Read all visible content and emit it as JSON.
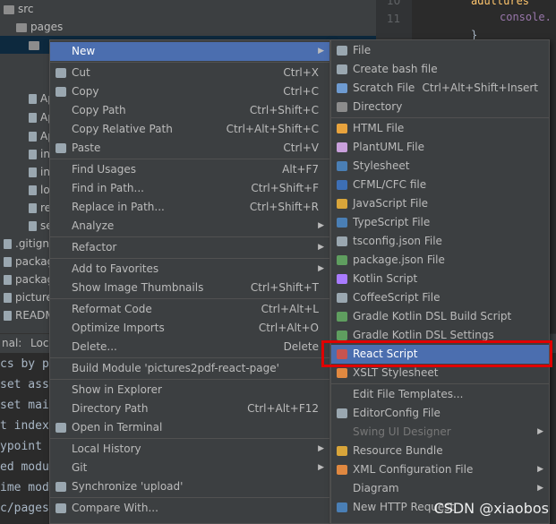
{
  "tree": {
    "rows": [
      {
        "label": "src",
        "kind": "folder"
      },
      {
        "label": "pages",
        "kind": "folder"
      },
      {
        "label": "",
        "kind": "folder"
      },
      {
        "label": "App",
        "kind": "file"
      },
      {
        "label": "App",
        "kind": "file"
      },
      {
        "label": "App",
        "kind": "file"
      },
      {
        "label": "inde",
        "kind": "file"
      },
      {
        "label": "inde",
        "kind": "file"
      },
      {
        "label": "logo",
        "kind": "file"
      },
      {
        "label": "repo",
        "kind": "file"
      },
      {
        "label": "setu",
        "kind": "file"
      },
      {
        "label": ".gitigno",
        "kind": "file"
      },
      {
        "label": "packag",
        "kind": "file"
      },
      {
        "label": "packag",
        "kind": "file"
      },
      {
        "label": "picture",
        "kind": "file"
      },
      {
        "label": "READM",
        "kind": "file"
      }
    ]
  },
  "editor": {
    "gutter": [
      "10",
      "11"
    ],
    "lines": [
      "adultures",
      "console.",
      "}"
    ]
  },
  "bottom": {
    "tabs": [
      "nal:",
      "Loc"
    ],
    "terminal_lines": [
      "cs by pa",
      "set asse",
      "set main",
      "t index",
      "ypoint m",
      "ed modul",
      "ime modu",
      "c/pages/"
    ]
  },
  "context_menu": {
    "items": [
      {
        "label": "New",
        "shortcut": "",
        "submenu": true,
        "highlight": true,
        "icon": ""
      },
      {
        "sep": true
      },
      {
        "label": "Cut",
        "shortcut": "Ctrl+X",
        "icon": "cut-icon"
      },
      {
        "label": "Copy",
        "shortcut": "Ctrl+C",
        "icon": "copy-icon"
      },
      {
        "label": "Copy Path",
        "shortcut": "Ctrl+Shift+C",
        "icon": ""
      },
      {
        "label": "Copy Relative Path",
        "shortcut": "Ctrl+Alt+Shift+C",
        "icon": ""
      },
      {
        "label": "Paste",
        "shortcut": "Ctrl+V",
        "icon": "paste-icon"
      },
      {
        "sep": true
      },
      {
        "label": "Find Usages",
        "shortcut": "Alt+F7",
        "icon": ""
      },
      {
        "label": "Find in Path...",
        "shortcut": "Ctrl+Shift+F",
        "icon": ""
      },
      {
        "label": "Replace in Path...",
        "shortcut": "Ctrl+Shift+R",
        "icon": ""
      },
      {
        "label": "Analyze",
        "shortcut": "",
        "submenu": true,
        "icon": ""
      },
      {
        "sep": true
      },
      {
        "label": "Refactor",
        "shortcut": "",
        "submenu": true,
        "icon": ""
      },
      {
        "sep": true
      },
      {
        "label": "Add to Favorites",
        "shortcut": "",
        "submenu": true,
        "icon": ""
      },
      {
        "label": "Show Image Thumbnails",
        "shortcut": "Ctrl+Shift+T",
        "icon": ""
      },
      {
        "sep": true
      },
      {
        "label": "Reformat Code",
        "shortcut": "Ctrl+Alt+L",
        "icon": ""
      },
      {
        "label": "Optimize Imports",
        "shortcut": "Ctrl+Alt+O",
        "icon": ""
      },
      {
        "label": "Delete...",
        "shortcut": "Delete",
        "icon": ""
      },
      {
        "sep": true
      },
      {
        "label": "Build Module 'pictures2pdf-react-page'",
        "shortcut": "",
        "icon": ""
      },
      {
        "sep": true
      },
      {
        "label": "Show in Explorer",
        "shortcut": "",
        "icon": ""
      },
      {
        "label": "Directory Path",
        "shortcut": "Ctrl+Alt+F12",
        "icon": ""
      },
      {
        "label": "Open in Terminal",
        "shortcut": "",
        "icon": "terminal-icon"
      },
      {
        "sep": true
      },
      {
        "label": "Local History",
        "shortcut": "",
        "submenu": true,
        "icon": ""
      },
      {
        "label": "Git",
        "shortcut": "",
        "submenu": true,
        "icon": ""
      },
      {
        "label": "Synchronize 'upload'",
        "shortcut": "",
        "icon": "sync-icon"
      },
      {
        "sep": true
      },
      {
        "label": "Compare With...",
        "shortcut": "",
        "icon": "compare-icon"
      }
    ]
  },
  "submenu": {
    "items": [
      {
        "label": "File",
        "icon": "file-icon",
        "color": "#9aa7b0"
      },
      {
        "label": "Create bash file",
        "icon": "bash-file-icon",
        "color": "#9aa7b0"
      },
      {
        "label": "Scratch File",
        "shortcut": "Ctrl+Alt+Shift+Insert",
        "icon": "scratch-file-icon",
        "color": "#6e9bd1"
      },
      {
        "label": "Directory",
        "icon": "folder-icon",
        "color": "#8c8c8c"
      },
      {
        "sep": true
      },
      {
        "label": "HTML File",
        "icon": "html-file-icon",
        "color": "#e8a33d"
      },
      {
        "label": "PlantUML File",
        "icon": "plantuml-file-icon",
        "color": "#c9a0dc"
      },
      {
        "label": "Stylesheet",
        "icon": "css-file-icon",
        "color": "#4a7fb5"
      },
      {
        "label": "CFML/CFC file",
        "icon": "cfml-file-icon",
        "color": "#3d6fb5"
      },
      {
        "label": "JavaScript File",
        "icon": "js-file-icon",
        "color": "#d9a53a"
      },
      {
        "label": "TypeScript File",
        "icon": "ts-file-icon",
        "color": "#4a7fb5"
      },
      {
        "label": "tsconfig.json File",
        "icon": "tsconfig-file-icon",
        "color": "#9aa7b0"
      },
      {
        "label": "package.json File",
        "icon": "package-json-icon",
        "color": "#5f9e5f"
      },
      {
        "label": "Kotlin Script",
        "icon": "kotlin-icon",
        "color": "#a97bff"
      },
      {
        "label": "CoffeeScript File",
        "icon": "coffeescript-icon",
        "color": "#9aa7b0"
      },
      {
        "label": "Gradle Kotlin DSL Build Script",
        "icon": "gradle-icon",
        "color": "#5f9e5f"
      },
      {
        "label": "Gradle Kotlin DSL Settings",
        "icon": "gradle-settings-icon",
        "color": "#5f9e5f"
      },
      {
        "label": "React Script",
        "icon": "react-file-icon",
        "color": "#c75450",
        "highlight": true
      },
      {
        "label": "XSLT Stylesheet",
        "icon": "xslt-file-icon",
        "color": "#e08840"
      },
      {
        "sep": true
      },
      {
        "label": "Edit File Templates...",
        "icon": ""
      },
      {
        "label": "EditorConfig File",
        "icon": "gear-icon",
        "color": "#9aa7b0"
      },
      {
        "label": "Swing UI Designer",
        "submenu": true,
        "disabled": true,
        "icon": ""
      },
      {
        "label": "Resource Bundle",
        "icon": "resource-bundle-icon",
        "color": "#d9a53a"
      },
      {
        "label": "XML Configuration File",
        "submenu": true,
        "icon": "xml-file-icon",
        "color": "#e08840"
      },
      {
        "label": "Diagram",
        "submenu": true,
        "icon": ""
      },
      {
        "label": "New HTTP Request",
        "icon": "http-request-icon",
        "color": "#4a7fb5"
      }
    ]
  },
  "watermark": "CSDN @xiaobos"
}
